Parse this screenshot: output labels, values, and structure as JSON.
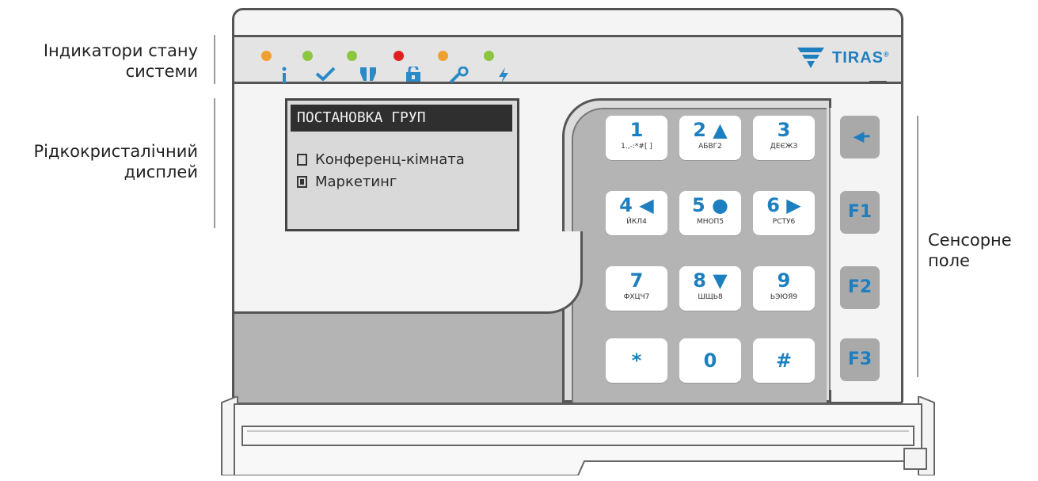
{
  "annotations": {
    "indicators": "Індикатори стану\nсистеми",
    "indicators_l1": "Індикатори стану",
    "indicators_l2": "системи",
    "lcd_l1": "Рідкокристалічний",
    "lcd_l2": "дисплей",
    "touch_l1": "Сенсорне",
    "touch_l2": "поле"
  },
  "logo": {
    "text": "TIRAS",
    "mark": "®"
  },
  "indicators": [
    {
      "led_color": "#f0a030",
      "icon": "info-icon"
    },
    {
      "led_color": "#8cc63f",
      "icon": "check-icon"
    },
    {
      "led_color": "#8cc63f",
      "icon": "shield-icon"
    },
    {
      "led_color": "#e02020",
      "icon": "lock-icon"
    },
    {
      "led_color": "#f0a030",
      "icon": "wrench-icon"
    },
    {
      "led_color": "#8cc63f",
      "icon": "lightning-icon"
    }
  ],
  "lcd": {
    "header": "ПОСТАНОВКА ГРУП",
    "items": [
      {
        "label": "Конференц-кімната",
        "checked": false
      },
      {
        "label": "Маркетинг",
        "checked": true
      }
    ]
  },
  "keys": [
    {
      "main": "1",
      "sub": "1.,-:*#[ ]"
    },
    {
      "main": "2 ▲",
      "sub": "АБВГ2"
    },
    {
      "main": "3",
      "sub": "ДЕЄЖЗ"
    },
    {
      "main": "4 ◀",
      "sub": "ЙКЛ4"
    },
    {
      "main": "5 ●",
      "sub": "МНОП5"
    },
    {
      "main": "6 ▶",
      "sub": "РСТУ6"
    },
    {
      "main": "7",
      "sub": "ФХЦЧ7"
    },
    {
      "main": "8 ▼",
      "sub": "ШЩЬ8"
    },
    {
      "main": "9",
      "sub": "ЬЭЮЯ9"
    },
    {
      "main": "*",
      "sub": ""
    },
    {
      "main": "0",
      "sub": ""
    },
    {
      "main": "#",
      "sub": ""
    }
  ],
  "fkeys": [
    "◀━",
    "F1",
    "F2",
    "F3"
  ],
  "colors": {
    "accent": "#1e7fc0",
    "body": "#f4f4f4",
    "keypad": "#b4b4b4"
  }
}
